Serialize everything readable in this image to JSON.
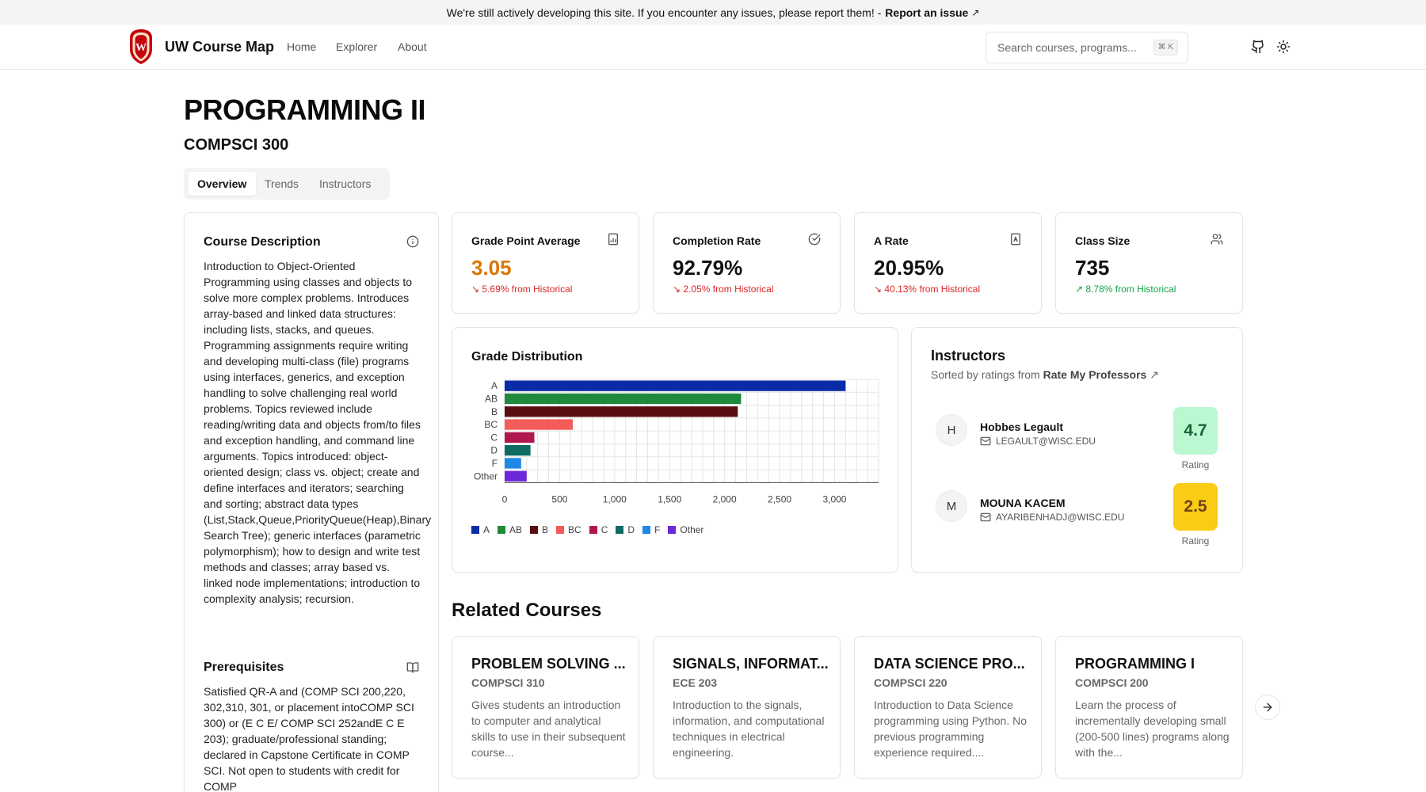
{
  "banner": {
    "message": "We're still actively developing this site. If you encounter any issues, please report them! -",
    "link_label": "Report an issue",
    "link_arrow": "↗"
  },
  "nav": {
    "brand": "UW Course Map",
    "links": [
      "Home",
      "Explorer",
      "About"
    ],
    "search_placeholder": "Search courses, programs...",
    "search_shortcut": "⌘ K",
    "icons": [
      "github-icon",
      "sun-icon"
    ],
    "logo_letter": "W"
  },
  "course": {
    "title": "PROGRAMMING II",
    "code": "COMPSCI 300"
  },
  "tabs": [
    "Overview",
    "Trends",
    "Instructors"
  ],
  "description": {
    "title": "Course Description",
    "text": "Introduction to Object-Oriented Programming using classes and objects to solve more complex problems. Introduces array-based and linked data structures: including lists, stacks, and queues. Programming assignments require writing and developing multi-class (file) programs using interfaces, generics, and exception handling to solve challenging real world problems. Topics reviewed include reading/writing data and objects from/to files and exception handling, and command line arguments. Topics introduced: object-oriented design; class vs. object; create and define interfaces and iterators; searching and sorting; abstract data types (List,Stack,Queue,PriorityQueue(Heap),Binary Search Tree); generic interfaces (parametric polymorphism); how to design and write test methods and classes; array based vs. linked node implementations; introduction to complexity analysis; recursion."
  },
  "prerequisites": {
    "title": "Prerequisites",
    "text": "Satisfied QR-A and (COMP SCI 200,220, 302,310, 301, or placement intoCOMP SCI 300) or (E C E/ COMP SCI  252andE C E 203); graduate/professional standing; declared in Capstone Certificate in COMP SCI. Not open to students with credit for COMP"
  },
  "stats": [
    {
      "title": "Grade Point Average",
      "value": "3.05",
      "delta": "5.69% from Historical",
      "direction": "down",
      "icon": "file-chart-icon",
      "value_color": "#d97706"
    },
    {
      "title": "Completion Rate",
      "value": "92.79%",
      "delta": "2.05% from Historical",
      "direction": "down",
      "icon": "check-circle-icon",
      "value_color": "#111111"
    },
    {
      "title": "A Rate",
      "value": "20.95%",
      "delta": "40.13% from Historical",
      "direction": "down",
      "icon": "letter-a-icon",
      "value_color": "#111111"
    },
    {
      "title": "Class Size",
      "value": "735",
      "delta": "8.78% from Historical",
      "direction": "up",
      "icon": "users-icon",
      "value_color": "#111111"
    }
  ],
  "chart_data": {
    "type": "bar",
    "orientation": "horizontal",
    "title": "Grade Distribution",
    "categories": [
      "A",
      "AB",
      "B",
      "BC",
      "C",
      "D",
      "F",
      "Other"
    ],
    "values": [
      3100,
      2150,
      2120,
      620,
      270,
      235,
      150,
      200
    ],
    "colors": [
      "#0a2ba8",
      "#1f8a3c",
      "#5a0e14",
      "#f45b5b",
      "#b0174d",
      "#0e6b63",
      "#1e88e5",
      "#6d28d9"
    ],
    "xticks": [
      "0",
      "500",
      "1,000",
      "1,500",
      "2,000",
      "2,500",
      "3,000"
    ],
    "xlim": [
      0,
      3400
    ],
    "grid": true,
    "legend": "bottom-left"
  },
  "instructors": {
    "title": "Instructors",
    "subtitle": "Sorted by ratings from",
    "subtitle_link": "Rate My Professors",
    "link_arrow": "↗",
    "rating_label": "Rating",
    "list": [
      {
        "initial": "H",
        "name": "Hobbes Legault",
        "email": "LEGAULT@WISC.EDU",
        "rating": "4.7",
        "rating_bg": "#bbf7d0",
        "rating_color": "#166534"
      },
      {
        "initial": "M",
        "name": "MOUNA KACEM",
        "email": "AYARIBENHADJ@WISC.EDU",
        "rating": "2.5",
        "rating_bg": "#facc15",
        "rating_color": "#713f12"
      }
    ]
  },
  "related": {
    "title": "Related Courses",
    "courses": [
      {
        "name": "PROBLEM SOLVING ...",
        "code": "COMPSCI 310",
        "desc": "Gives students an introduction to computer and analytical skills to use in their subsequent course..."
      },
      {
        "name": "SIGNALS, INFORMAT...",
        "code": "ECE 203",
        "desc": "Introduction to the signals, information, and computational techniques in electrical engineering."
      },
      {
        "name": "DATA SCIENCE PRO...",
        "code": "COMPSCI 220",
        "desc": "Introduction to Data Science programming using Python. No previous programming experience required...."
      },
      {
        "name": "PROGRAMMING I",
        "code": "COMPSCI 200",
        "desc": "Learn the process of incrementally developing small (200-500 lines) programs along with the..."
      }
    ]
  }
}
